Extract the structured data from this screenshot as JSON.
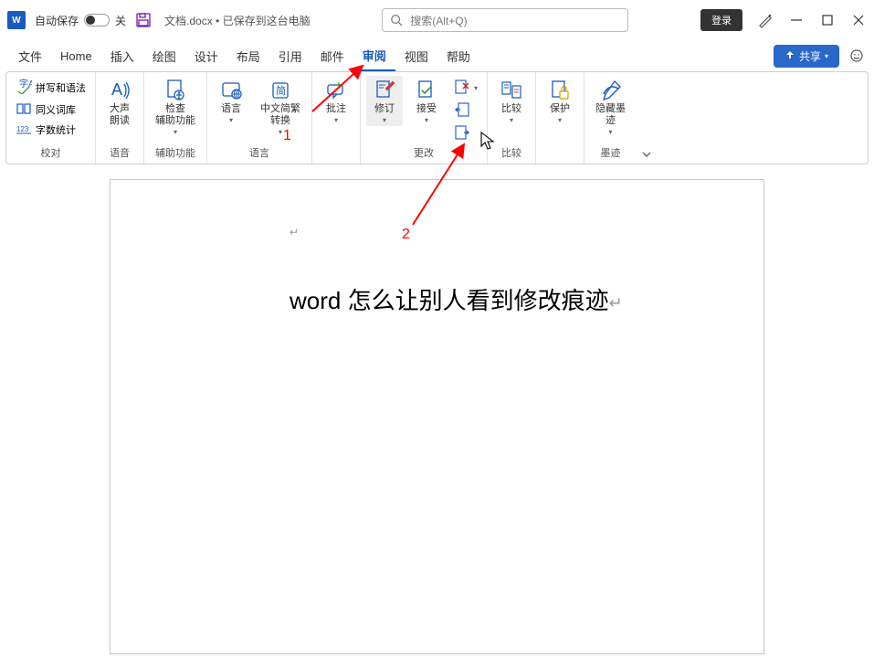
{
  "titlebar": {
    "app_letter": "W",
    "autosave_label": "自动保存",
    "autosave_state_label": "关",
    "doc_title": "文档.docx • 已保存到这台电脑",
    "search_placeholder": "搜索(Alt+Q)",
    "login_label": "登录"
  },
  "menubar": {
    "tabs": [
      {
        "label": "文件"
      },
      {
        "label": "Home"
      },
      {
        "label": "插入"
      },
      {
        "label": "绘图"
      },
      {
        "label": "设计"
      },
      {
        "label": "布局"
      },
      {
        "label": "引用"
      },
      {
        "label": "邮件"
      },
      {
        "label": "审阅"
      },
      {
        "label": "视图"
      },
      {
        "label": "帮助"
      }
    ],
    "share_label": "共享"
  },
  "ribbon": {
    "groups": {
      "proofing": {
        "label": "校对",
        "spelling_label": "拼写和语法",
        "thesaurus_label": "同义词库",
        "wordcount_label": "字数统计"
      },
      "speech": {
        "label": "语音",
        "read_aloud_label": "大声\n朗读"
      },
      "accessibility": {
        "label": "辅助功能",
        "check_label": "检查\n辅助功能"
      },
      "language": {
        "label": "语言",
        "convert_label": "中文简繁\n转换",
        "btn_label": "语言"
      },
      "comments": {
        "label": "批注"
      },
      "changes": {
        "label": "更改",
        "track_label": "修订",
        "accept_label": "接受"
      },
      "compare": {
        "label": "比较",
        "btn_label": "比较"
      },
      "protect": {
        "label": "保护"
      },
      "ink": {
        "label": "墨迹",
        "btn_label": "隐藏墨\n迹"
      }
    }
  },
  "document": {
    "body_text": "word 怎么让别人看到修改痕迹"
  },
  "annotations": {
    "label1": "1",
    "label2": "2"
  }
}
